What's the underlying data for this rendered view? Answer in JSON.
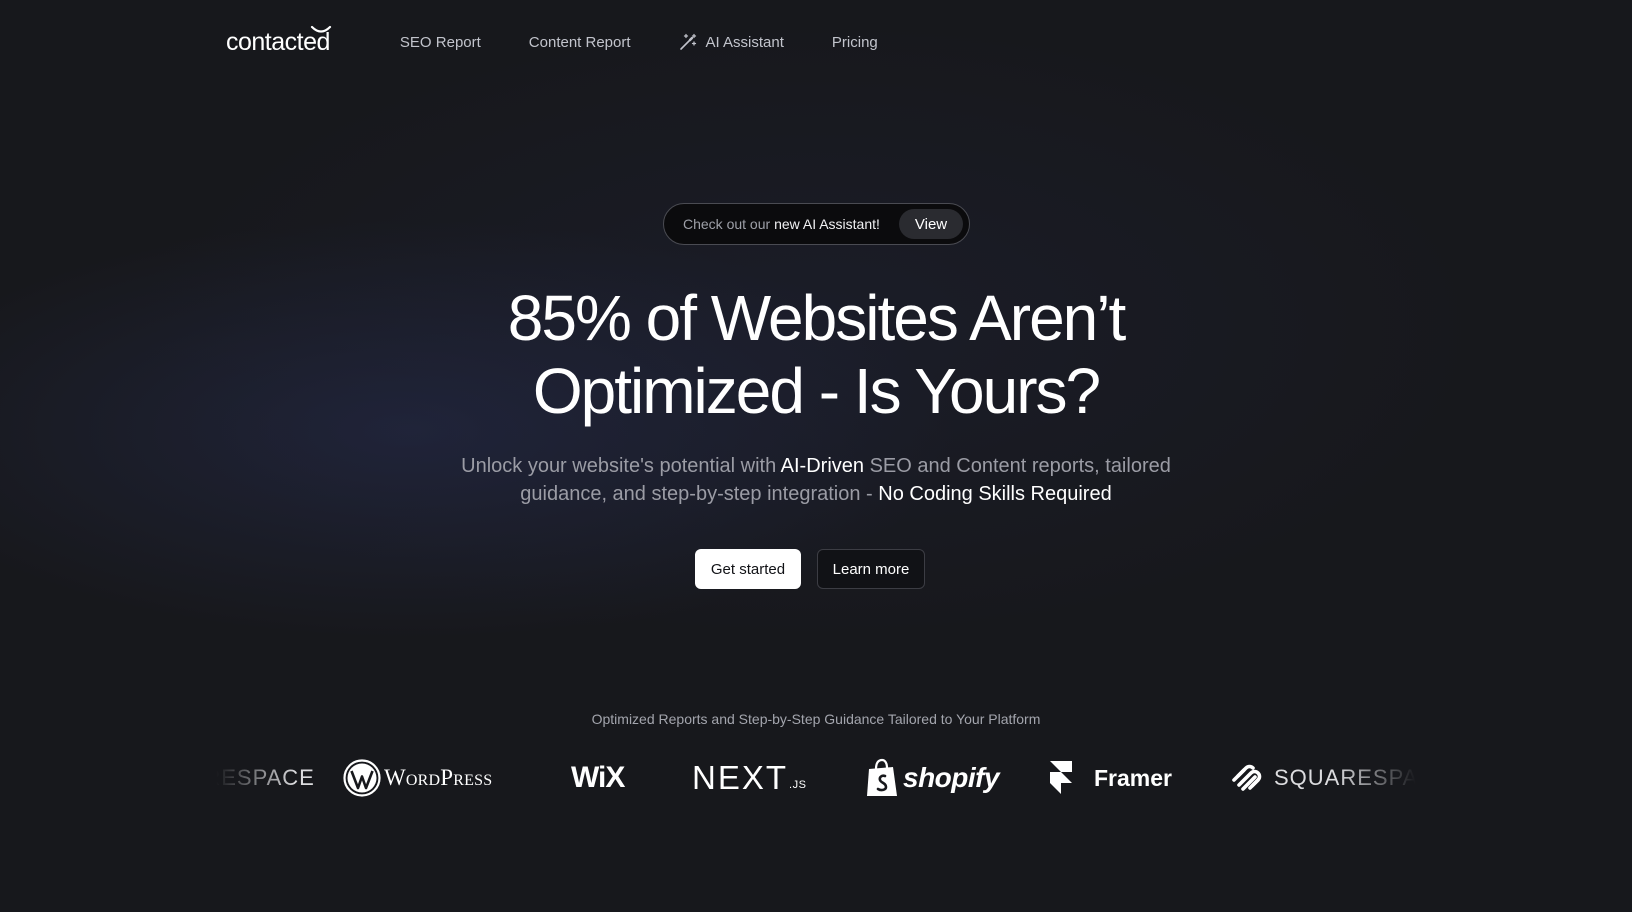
{
  "nav": {
    "logo": "contacted",
    "items": [
      {
        "label": "SEO Report"
      },
      {
        "label": "Content Report"
      },
      {
        "label": "AI Assistant",
        "icon": "magic-wand-icon"
      },
      {
        "label": "Pricing"
      }
    ]
  },
  "announcement": {
    "prefix": "Check out our ",
    "highlight": "new AI Assistant!",
    "button": "View"
  },
  "hero": {
    "title_line1": "85% of Websites Aren’t",
    "title_line2": "Optimized - Is Yours?",
    "sub_part1": "Unlock your website's potential with ",
    "sub_em1": "AI-Driven",
    "sub_part2": " SEO and Content reports, tailored guidance, and step-by-step integration - ",
    "sub_em2": "No Coding Skills Required"
  },
  "cta": {
    "primary": "Get started",
    "secondary": "Learn more"
  },
  "platforms": {
    "caption": "Optimized Reports and Step-by-Step Guidance Tailored to Your Platform",
    "logos": [
      {
        "name": "SQUARESPACE",
        "icon": "squarespace-icon"
      },
      {
        "name": "WordPress",
        "icon": "wordpress-icon"
      },
      {
        "name": "WiX",
        "icon": "wix-logo"
      },
      {
        "name": "NEXT",
        "suffix": ".JS",
        "icon": "nextjs-logo"
      },
      {
        "name": "shopify",
        "icon": "shopify-bag-icon"
      },
      {
        "name": "Framer",
        "icon": "framer-icon"
      },
      {
        "name": "SQUARESPACE",
        "icon": "squarespace-icon"
      }
    ]
  },
  "colors": {
    "background": "#17181c",
    "text_muted": "#9b9ca5",
    "accent_white": "#ffffff"
  }
}
